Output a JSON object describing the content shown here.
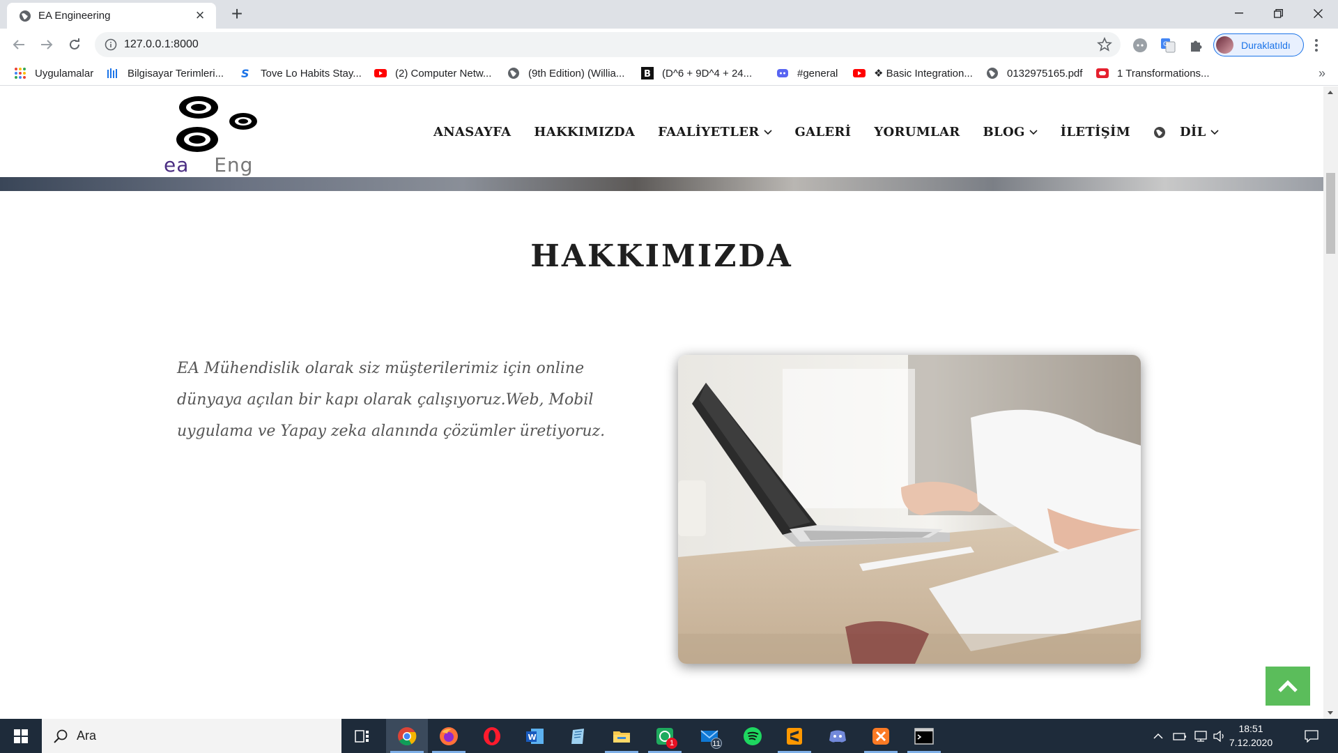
{
  "browser": {
    "tab_title": "EA Engineering",
    "url": "127.0.0.1:8000",
    "profile_label": "Duraklatıldı",
    "bookmarks": [
      {
        "label": "Uygulamalar",
        "icon": "apps-grid-icon"
      },
      {
        "label": "Bilgisayar Terimleri...",
        "icon": "bars-icon"
      },
      {
        "label": "Tove Lo Habits Stay...",
        "icon": "s-logo-icon"
      },
      {
        "label": "(2) Computer Netw...",
        "icon": "youtube-icon"
      },
      {
        "label": "(9th Edition) (Willia...",
        "icon": "globe-icon"
      },
      {
        "label": "(D^6 + 9D^4 + 24...",
        "icon": "b-logo-icon"
      },
      {
        "label": "#general",
        "icon": "discord-icon"
      },
      {
        "label": "❖ Basic Integration...",
        "icon": "youtube-icon"
      },
      {
        "label": "0132975165.pdf",
        "icon": "globe-icon"
      },
      {
        "label": "1 Transformations...",
        "icon": "oracle-icon"
      }
    ],
    "bookmarks_more": "»"
  },
  "site": {
    "logo": {
      "part1": "ea",
      "part2": "Eng"
    },
    "nav": [
      {
        "label": "ANASAYFA",
        "dropdown": false
      },
      {
        "label": "HAKKIMIZDA",
        "dropdown": false
      },
      {
        "label": "FAALİYETLER",
        "dropdown": true
      },
      {
        "label": "GALERİ",
        "dropdown": false
      },
      {
        "label": "YORUMLAR",
        "dropdown": false
      },
      {
        "label": "BLOG",
        "dropdown": true
      },
      {
        "label": "İLETİŞİM",
        "dropdown": false
      }
    ],
    "lang_label": "DİL",
    "section_title": "HAKKIMIZDA",
    "about_text": "EA Mühendislik olarak siz müşterilerimiz için online dünyaya açılan bir kapı olarak çalışıyoruz.Web, Mobil uygulama ve Yapay zeka alanında çözümler üretiyoruz.",
    "colors": {
      "to_top_button": "#5bbd5b",
      "logo_ea": "#4b2e83"
    }
  },
  "taskbar": {
    "search_placeholder": "Ara",
    "apps": [
      "task-view-icon",
      "chrome-icon",
      "firefox-icon",
      "opera-icon",
      "word-icon",
      "notepad-icon",
      "file-explorer-icon",
      "whatsapp-icon",
      "mail-icon",
      "spotify-icon",
      "sublime-icon",
      "discord-icon",
      "xampp-icon",
      "terminal-icon"
    ],
    "badges": {
      "whatsapp": "1",
      "mail": "11"
    },
    "time": "18:51",
    "date": "7.12.2020"
  }
}
